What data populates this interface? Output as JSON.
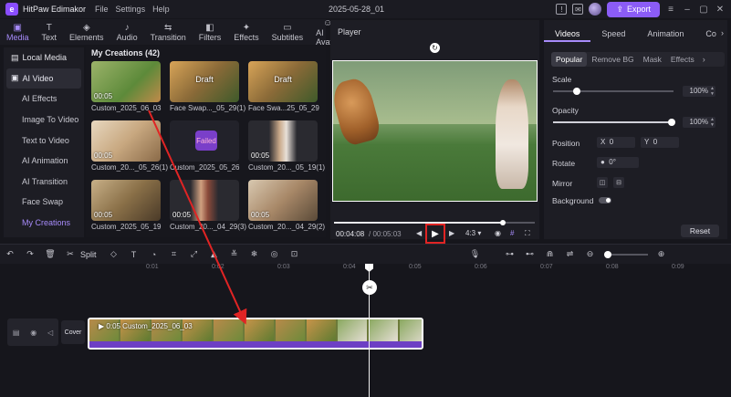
{
  "titlebar": {
    "app_name": "HitPaw Edimakor",
    "menu": [
      "File",
      "Settings",
      "Help"
    ],
    "project_title": "2025-05-28_01",
    "export_label": "Export"
  },
  "tooltabs": [
    {
      "label": "Media",
      "icon": "media-icon"
    },
    {
      "label": "Text",
      "icon": "text-icon"
    },
    {
      "label": "Elements",
      "icon": "elements-icon"
    },
    {
      "label": "Audio",
      "icon": "audio-icon"
    },
    {
      "label": "Transition",
      "icon": "transition-icon"
    },
    {
      "label": "Filters",
      "icon": "filters-icon"
    },
    {
      "label": "Effects",
      "icon": "effects-icon"
    },
    {
      "label": "Subtitles",
      "icon": "subtitles-icon"
    },
    {
      "label": "AI Avatar",
      "icon": "ai-avatar-icon"
    }
  ],
  "leftnav": {
    "items": [
      "Local Media",
      "AI Video",
      "AI Effects",
      "Image To Video",
      "Text to Video",
      "AI Animation",
      "AI Transition",
      "Face Swap",
      "My Creations"
    ]
  },
  "media": {
    "header": "My Creations (42)",
    "items": [
      {
        "label": "Custom_2025_06_03",
        "duration": "00:05",
        "badge": ""
      },
      {
        "label": "Face Swap..._05_29(1)",
        "duration": "",
        "badge": "Draft"
      },
      {
        "label": "Face Swa...25_05_29",
        "duration": "",
        "badge": "Draft"
      },
      {
        "label": "Custom_20..._05_26(1)",
        "duration": "00:05",
        "badge": ""
      },
      {
        "label": "Custom_2025_05_26",
        "duration": "",
        "badge": "Failed"
      },
      {
        "label": "Custom_20..._05_19(1)",
        "duration": "00:05",
        "badge": ""
      },
      {
        "label": "Custom_2025_05_19",
        "duration": "00:05",
        "badge": ""
      },
      {
        "label": "Custom_20..._04_29(3)",
        "duration": "00:05",
        "badge": ""
      },
      {
        "label": "Custom_20..._04_29(2)",
        "duration": "00:05",
        "badge": ""
      }
    ]
  },
  "player": {
    "label": "Player",
    "current_time": "00:04:08",
    "total_time": "/ 00:05:03",
    "ratio": "4:3",
    "progress": 0.84
  },
  "rpanel": {
    "tabs": [
      "Videos",
      "Speed",
      "Animation",
      "Co"
    ],
    "subtabs": [
      "Popular",
      "Remove BG",
      "Mask",
      "Effects"
    ],
    "scale_label": "Scale",
    "scale_value": "100%",
    "opacity_label": "Opacity",
    "opacity_value": "100%",
    "position_label": "Position",
    "pos_x_label": "X",
    "pos_x": "0",
    "pos_y_label": "Y",
    "pos_y": "0",
    "rotate_label": "Rotate",
    "rotate_value": "0°",
    "mirror_label": "Mirror",
    "background_label": "Background",
    "reset_label": "Reset"
  },
  "timeline": {
    "split_label": "Split",
    "ticks": [
      "0:01",
      "0:02",
      "0:03",
      "0:04",
      "0:05",
      "0:06",
      "0:07",
      "0:08",
      "0:09"
    ],
    "cover_label": "Cover",
    "clip_name": "0:05 Custom_2025_06_03"
  },
  "colors": {
    "accent": "#8b5cf6",
    "highlight_box": "#e02424"
  }
}
